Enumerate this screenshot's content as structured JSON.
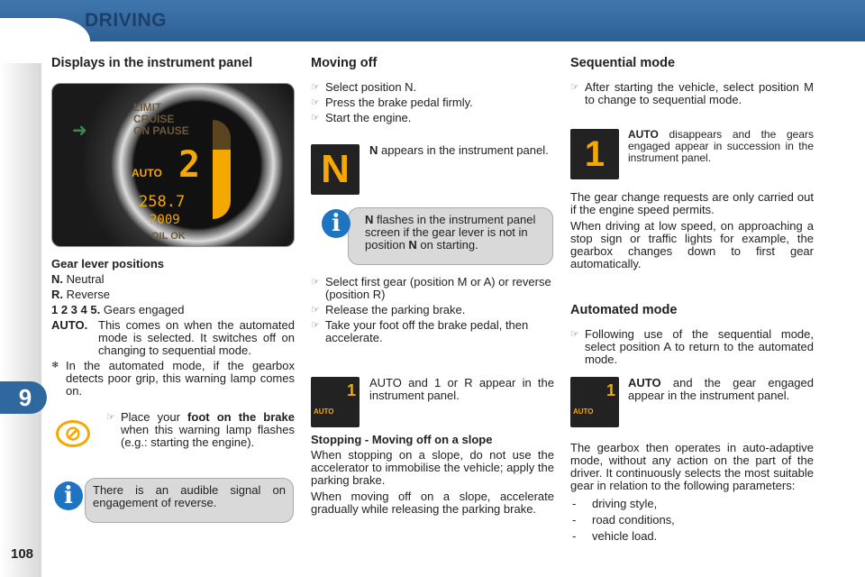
{
  "header": {
    "title": "DRIVING"
  },
  "chapter_tab": "9",
  "page_number": "108",
  "col1": {
    "title": "Displays in the instrument panel",
    "panel": {
      "auto": "AUTO",
      "gear": "2",
      "odometer": "258.7",
      "trip": "2009",
      "oil": "OIL OK",
      "labels": [
        "LIMIT",
        "CRUISE",
        "ON PAUSE"
      ]
    },
    "gear_title": "Gear lever positions",
    "defs": [
      {
        "k": "N.",
        "v": "Neutral"
      },
      {
        "k": "R.",
        "v": "Reverse"
      },
      {
        "k": "1 2 3 4 5.",
        "v": "Gears engaged"
      },
      {
        "k": "AUTO.",
        "v": "This comes on when the automated mode is selected. It switches off on changing to sequential mode."
      }
    ],
    "grip_note": "In the automated mode, if the gearbox detects poor grip, this warning lamp comes on.",
    "foot_pre": "Place your ",
    "foot_bold": "foot on the brake",
    "foot_post": " when this warning lamp flashes (e.g.: starting the engine).",
    "info": "There is an audible signal on engagement of reverse."
  },
  "col2": {
    "title": "Moving off",
    "steps1": [
      "Select position N.",
      "Press the brake pedal firmly.",
      "Start the engine."
    ],
    "n_screen": "N",
    "n_bold": "N",
    "n_text": " appears in the instrument panel.",
    "info_bold": "N",
    "info_text": " flashes in the instrument panel screen if the gear lever is not in position ",
    "info_bold2": "N",
    "info_text2": " on starting.",
    "steps2": [
      "Select first gear (position M or A) or reverse (position R)",
      "Release the parking brake.",
      "Take your foot off the brake pedal, then accelerate."
    ],
    "auto_text": "AUTO and 1 or R appear in the instrument panel.",
    "screen_auto": "AUTO",
    "screen_gear": "1",
    "slope_title": "Stopping - Moving off on a slope",
    "slope_p1": "When stopping on a slope, do not use the accelerator to immobilise the vehicle; apply the parking brake.",
    "slope_p2": "When moving off on a slope, accelerate gradually while releasing the parking brake."
  },
  "col3": {
    "title": "Sequential mode",
    "step": "After starting the vehicle, select position M to change to sequential mode.",
    "screen_gear": "1",
    "auto_bold": "AUTO",
    "auto_text": " disappears and the gears engaged appear in succession in the instrument panel.",
    "p1": "The gear change requests are only carried out if the engine speed permits.",
    "p2": "When driving at low speed, on approaching a stop sign or traffic lights for example, the gearbox changes down to first gear automatically.",
    "title2": "Automated mode",
    "step2": "Following use of the sequential mode, select position A to return to the automated mode.",
    "auto2_bold": "AUTO",
    "auto2_text": " and the gear engaged appear in the instrument panel.",
    "screen2_auto": "AUTO",
    "screen2_gear": "1",
    "p3": "The gearbox then operates in auto-adaptive mode, without any action on the part of the driver. It continuously selects the most suitable gear in relation to the following parameters:",
    "params": [
      "driving style,",
      "road conditions,",
      "vehicle load."
    ]
  },
  "colors": {
    "header": "#2d5f94",
    "accent_orange": "#f5a800",
    "info_blue": "#1f74c2"
  }
}
